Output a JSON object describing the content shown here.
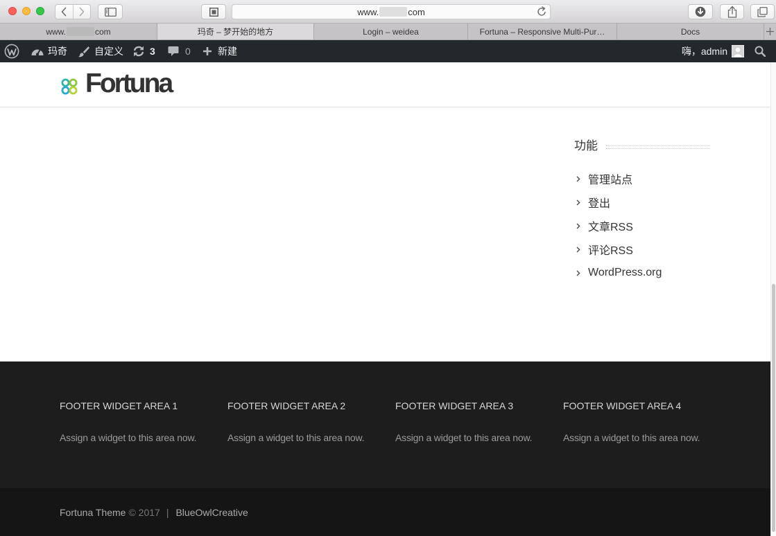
{
  "browser": {
    "url": {
      "prefix": "www.",
      "suffix": "com"
    },
    "tabs": [
      {
        "prefix": "www.",
        "suffix": "com",
        "active": false
      },
      {
        "label": "玛奇 – 梦开始的地方",
        "active": true
      },
      {
        "label": "Login – weidea",
        "active": false
      },
      {
        "label": "Fortuna – Responsive Multi-Pur…",
        "active": false
      },
      {
        "label": "Docs",
        "active": false
      }
    ]
  },
  "admin_bar": {
    "site_name": "玛奇",
    "customize_label": "自定义",
    "updates_count": "3",
    "comments_count": "0",
    "new_label": "新建",
    "greeting": "嗨，admin"
  },
  "header": {
    "logo_text": "Fortuna"
  },
  "sidebar": {
    "widget_title": "功能",
    "links": [
      "管理站点",
      "登出",
      "文章RSS",
      "评论RSS",
      "WordPress.org"
    ]
  },
  "footer": {
    "widgets": [
      {
        "title": "FOOTER WIDGET AREA 1",
        "text": "Assign a widget to this area now."
      },
      {
        "title": "FOOTER WIDGET AREA 2",
        "text": "Assign a widget to this area now."
      },
      {
        "title": "FOOTER WIDGET AREA 3",
        "text": "Assign a widget to this area now."
      },
      {
        "title": "FOOTER WIDGET AREA 4",
        "text": "Assign a widget to this area now."
      }
    ],
    "credits": {
      "theme": "Fortuna Theme",
      "copyright": "© 2017",
      "separator": "|",
      "author": "BlueOwlCreative"
    }
  },
  "icons": {
    "window_controls": [
      "close-light",
      "minimize-light",
      "zoom-light"
    ],
    "toolbar": [
      "back-icon",
      "forward-icon",
      "sidebar-icon",
      "reader-icon",
      "reload-icon",
      "downloads-icon",
      "share-icon",
      "tabs-overview-icon",
      "new-tab-icon"
    ],
    "admin_bar": [
      "wordpress-logo-icon",
      "dashboard-icon",
      "brush-icon",
      "updates-icon",
      "comment-icon",
      "plus-icon",
      "avatar",
      "search-icon"
    ],
    "logo": "clover-logo-icon",
    "list_bullet": "chevron-right-icon"
  },
  "colors": {
    "admin_bar_bg": "#23282d",
    "footer_bg": "#1d1d1d",
    "bottom_bar_bg": "#151515",
    "logo_teal": "#2fb3a6",
    "logo_green": "#8cc63f",
    "logo_blue": "#2aa8d0",
    "logo_lime": "#b5d334",
    "traffic_close": "#fc605c",
    "traffic_minimize": "#fdbc40",
    "traffic_zoom": "#34c84a"
  }
}
